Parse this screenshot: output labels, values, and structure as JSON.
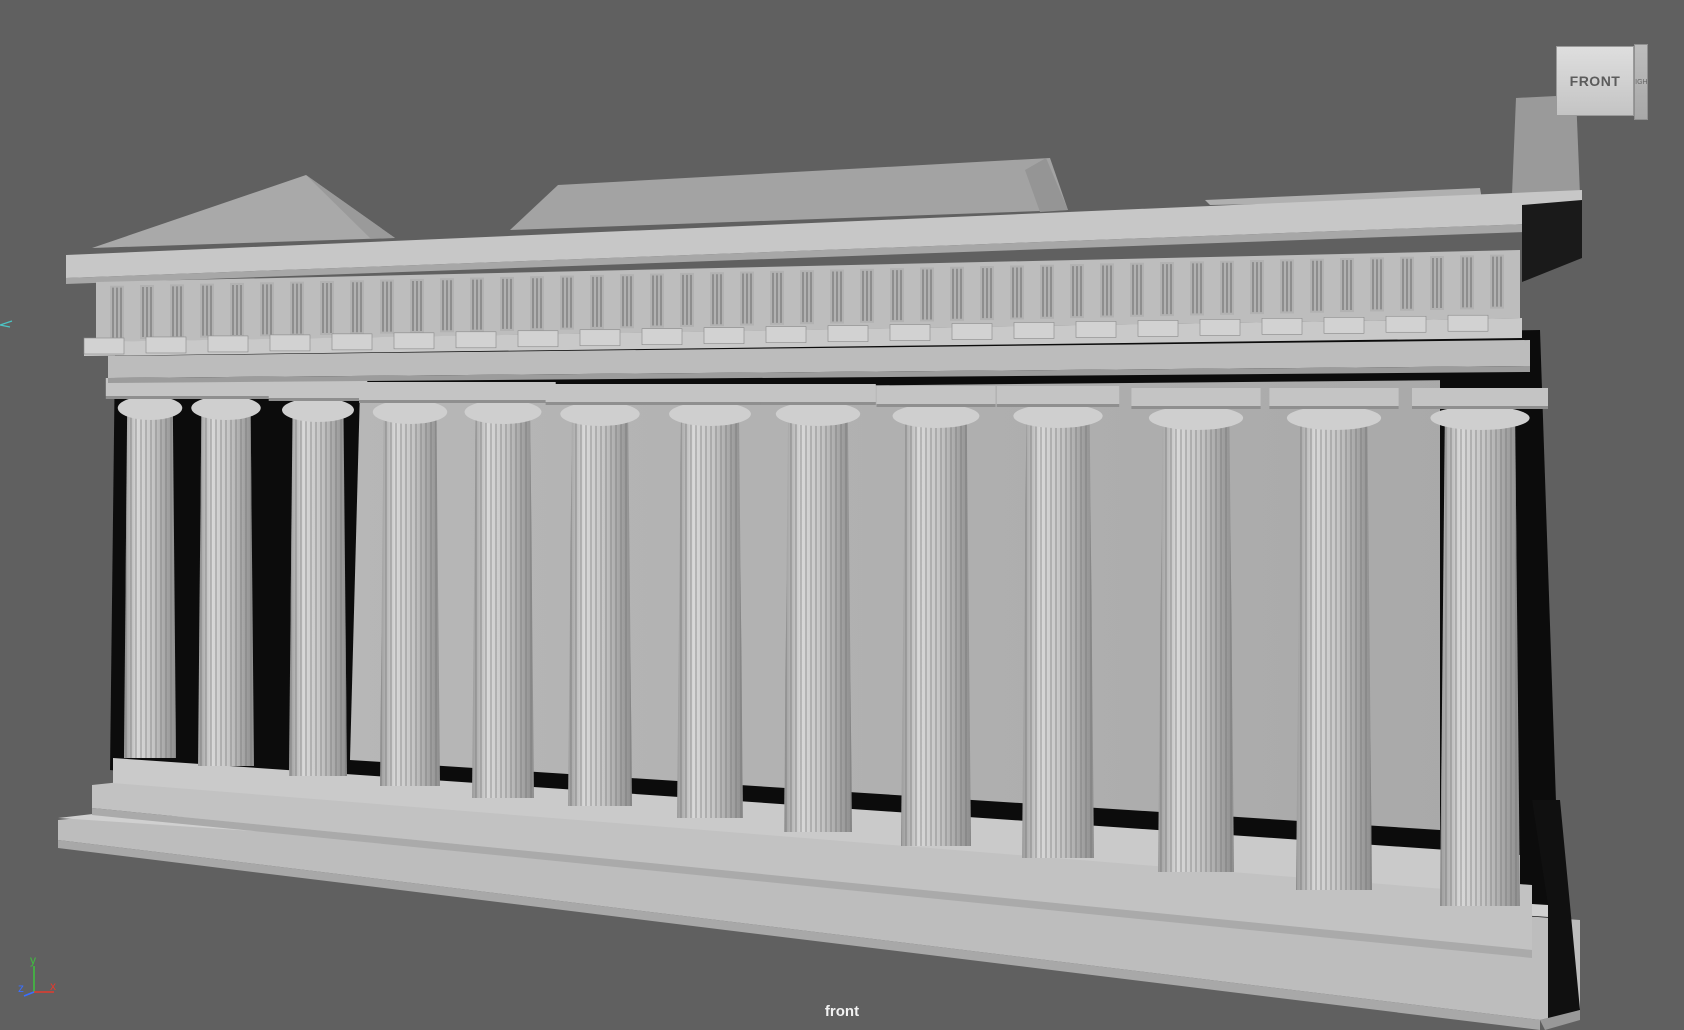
{
  "viewport": {
    "camera_label": "front",
    "background_color": "#606060"
  },
  "viewcube": {
    "front_label": "FRONT",
    "right_label": "RIGHT"
  },
  "axis_gizmo": {
    "y_label": "y",
    "z_label": "z",
    "x_label": "x",
    "y_color": "#3fbf3f",
    "z_color": "#3a6fff",
    "x_color": "#e33b2e"
  },
  "model": {
    "name": "greek-temple",
    "column_count": 13
  }
}
